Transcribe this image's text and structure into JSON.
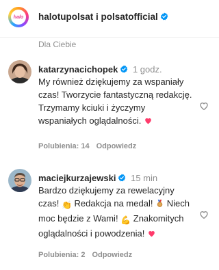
{
  "header": {
    "logo_text": "halo",
    "title": "halotupolsat i polsatofficial"
  },
  "filter": {
    "label": "Dla Ciebie"
  },
  "comments": [
    {
      "username": "katarzynacichopek",
      "time": "1 godz.",
      "text": "My również dziękujemy za wspaniały czas! Tworzycie fantastyczną redakcję. Trzymamy kciuki i życzymy wspaniałych oglądalności.",
      "likes": "Polubienia: 14",
      "reply": "Odpowiedz"
    },
    {
      "username": "maciejkurzajewski",
      "time": "15 min",
      "text_1": "Bardzo dziękujemy za rewelacyjny czas!",
      "text_2": "Redakcja na medal!",
      "text_3": "Niech moc będzie z Wami!",
      "text_4": "Znakomitych oglądalności i powodzenia!",
      "likes": "Polubienia: 2",
      "reply": "Odpowiedz"
    }
  ],
  "colors": {
    "verified": "#0095f6",
    "heart": "#ff3b6b",
    "muted": "#8e8e8e"
  },
  "icons": {
    "verified": "verified-badge-icon",
    "like": "heart-outline-icon"
  }
}
